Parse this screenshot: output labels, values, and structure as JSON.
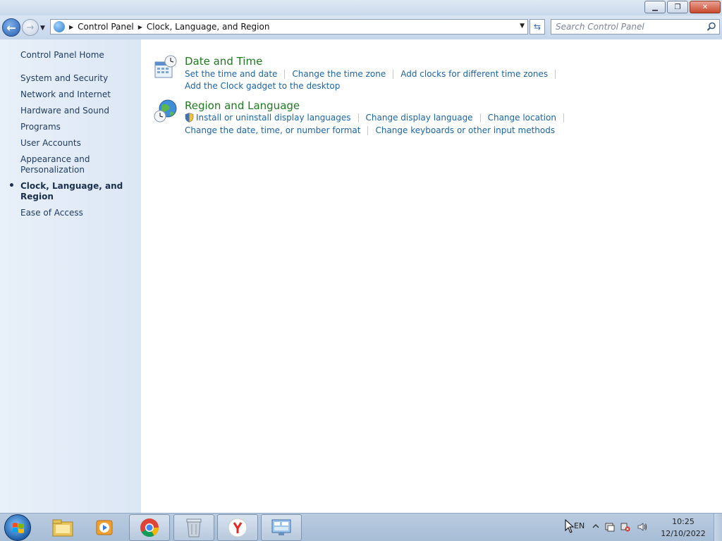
{
  "window": {
    "controls": {
      "minimize": "▁",
      "maximize": "❐",
      "close": "✕"
    }
  },
  "nav": {
    "back_glyph": "←",
    "forward_glyph": "→",
    "recent_glyph": "▼",
    "breadcrumbs": [
      "Control Panel",
      "Clock, Language, and Region"
    ],
    "separator_glyph": "▶",
    "dropdown_glyph": "▼",
    "refresh_glyph": "⇆"
  },
  "search": {
    "placeholder": "Search Control Panel"
  },
  "sidebar": {
    "home": "Control Panel Home",
    "items": [
      {
        "label": "System and Security"
      },
      {
        "label": "Network and Internet"
      },
      {
        "label": "Hardware and Sound"
      },
      {
        "label": "Programs"
      },
      {
        "label": "User Accounts"
      },
      {
        "label": "Appearance and Personalization"
      },
      {
        "label": "Clock, Language, and Region",
        "active": true
      },
      {
        "label": "Ease of Access"
      }
    ]
  },
  "categories": [
    {
      "title": "Date and Time",
      "links_row1": [
        "Set the time and date",
        "Change the time zone",
        "Add clocks for different time zones"
      ],
      "links_row2": [
        "Add the Clock gadget to the desktop"
      ]
    },
    {
      "title": "Region and Language",
      "links_row1": [
        "Install or uninstall display languages",
        "Change display language",
        "Change location"
      ],
      "links_row2": [
        "Change the date, time, or number format",
        "Change keyboards or other input methods"
      ]
    }
  ],
  "taskbar": {
    "items": [
      "explorer-icon",
      "media-player-icon",
      "chrome-icon",
      "recycle-bin-icon",
      "yandex-icon",
      "control-panel-icon"
    ],
    "tray": {
      "language": "EN",
      "time": "10:25",
      "date": "12/10/2022"
    }
  },
  "colors": {
    "category_title": "#1e7a1e",
    "link": "#1a64a8",
    "sidebar_text": "#1e3a5f"
  }
}
